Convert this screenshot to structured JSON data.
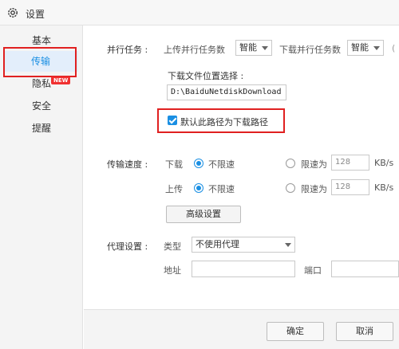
{
  "window": {
    "title": "设置"
  },
  "sidebar": {
    "items": [
      {
        "label": "基本"
      },
      {
        "label": "传输"
      },
      {
        "label": "隐私"
      },
      {
        "label": "安全"
      },
      {
        "label": "提醒"
      }
    ],
    "badge": "NEW"
  },
  "parallel": {
    "label": "并行任务 :",
    "upload_label": "上传并行任务数",
    "upload_value": "智能",
    "download_label": "下载并行任务数",
    "download_value": "智能",
    "overflow_glyph": "("
  },
  "download_location": {
    "label": "下载文件位置选择 :",
    "path": "D:\\BaiduNetdiskDownload",
    "default_checkbox_label": "默认此路径为下载路径",
    "default_checked": true
  },
  "speed": {
    "label": "传输速度 :",
    "download_label": "下载",
    "upload_label": "上传",
    "unlimited_label": "不限速",
    "limit_label": "限速为",
    "download_limit": "128",
    "upload_limit": "128",
    "unit": "KB/s"
  },
  "advanced_button": "高级设置",
  "proxy": {
    "label": "代理设置 :",
    "type_label": "类型",
    "type_value": "不使用代理",
    "address_label": "地址",
    "port_label": "端口"
  },
  "footer": {
    "ok": "确定",
    "cancel": "取消"
  },
  "colors": {
    "accent": "#1a8fe3",
    "highlight_border": "#e02020",
    "badge_bg": "#f03030"
  },
  "icons": {
    "title": "gear-icon",
    "dropdown": "chevron-down-icon"
  }
}
